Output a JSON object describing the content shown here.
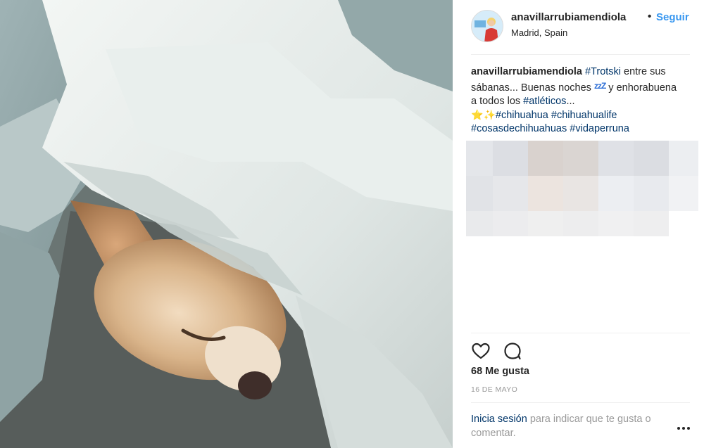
{
  "post": {
    "photo_alt": "chihuahua-photo",
    "author": {
      "username": "anavillarrubiamendiola",
      "separator": "•",
      "follow_label": "Seguir",
      "location": "Madrid, Spain",
      "avatar_icon": "profile-avatar"
    },
    "caption": {
      "username": "anavillarrubiamendiola",
      "tag_trotski": "#Trotski",
      "text_1": " entre sus sábanas... Buenas noches ",
      "zzz": "zzZ",
      "text_2": " y enhorabuena a todos los ",
      "tag_atleticos": "#atléticos",
      "text_3": "...",
      "emoji_star": "⭐",
      "emoji_sparkles": "✨",
      "tags": [
        "#chihuahua",
        "#chihuahualife",
        "#cosasdechihuahuas",
        "#vidaperruna"
      ]
    },
    "actions": {
      "like_icon": "heart-icon",
      "comment_icon": "comment-icon"
    },
    "likes_label": "68 Me gusta",
    "date": "16 DE MAYO",
    "login": {
      "link_label": "Inicia sesión",
      "text": " para indicar que te gusta o comentar."
    },
    "more_icon": "more-options-icon"
  },
  "colors": {
    "link_blue": "#3897f0",
    "hashtag": "#003569",
    "muted": "#999999",
    "text": "#262626"
  }
}
